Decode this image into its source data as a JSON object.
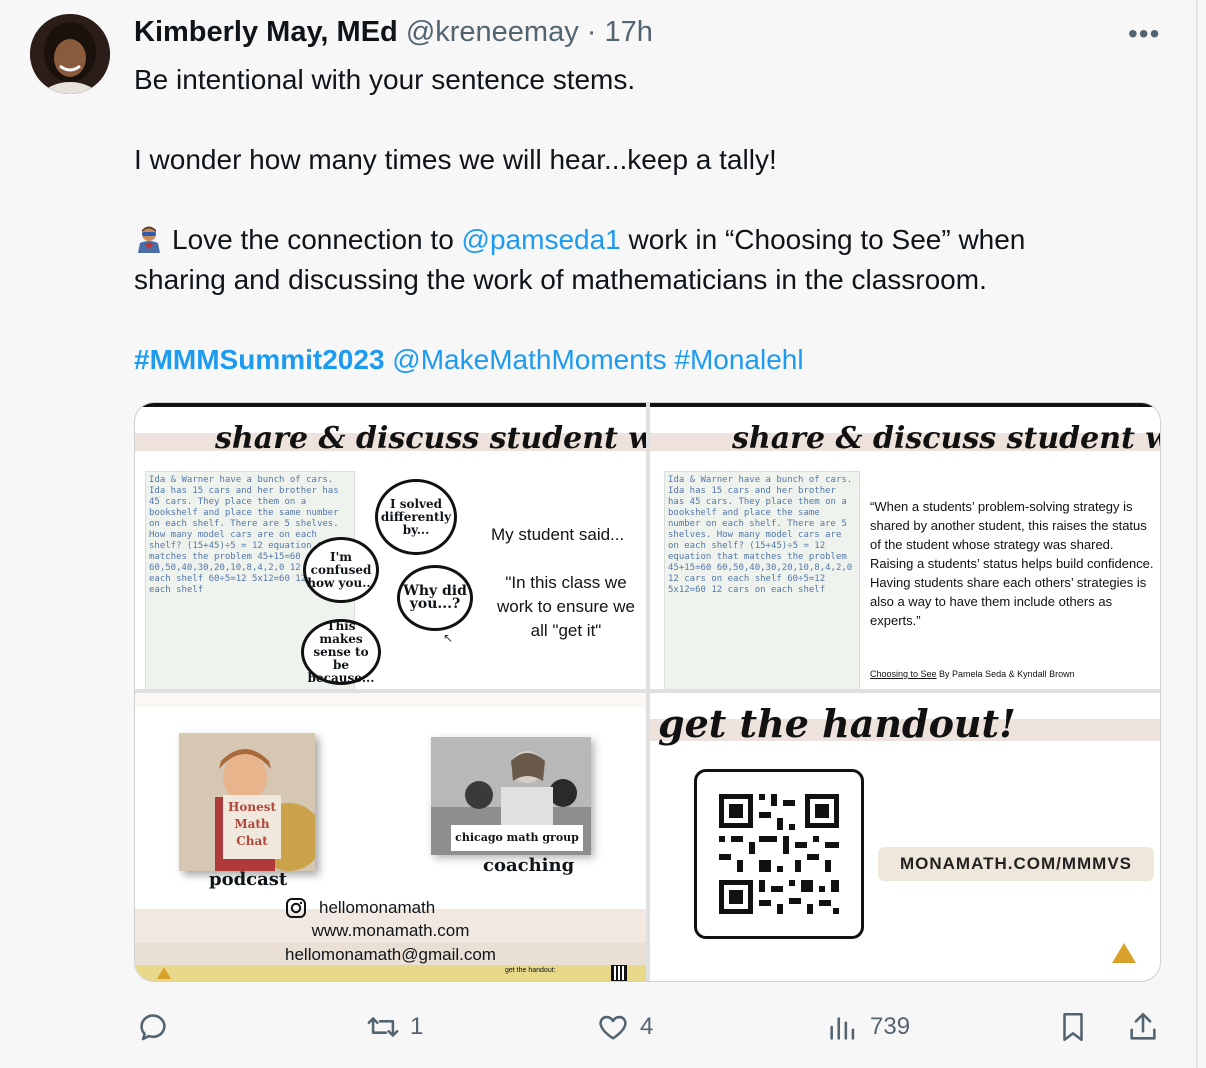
{
  "author": {
    "name": "Kimberly May, MEd",
    "handle": "@kreneemay",
    "time": "· 17h"
  },
  "tweet": {
    "line1": "Be intentional with your sentence stems.",
    "line2": "I wonder how many times we will hear...keep a tally!",
    "line3_pre": "Love the connection to ",
    "line3_mention": "@pamseda1",
    "line3_post": " work in “Choosing to See” when",
    "line4": "sharing and discussing the work of mathematicians in the classroom.",
    "hashtag1": "#MMMSummit2023",
    "mention2": "@MakeMathMoments",
    "hashtag2": "#Monalehl"
  },
  "slide1": {
    "title": "share & discuss student work",
    "bubble1": "I solved differently by...",
    "bubble2": "I'm confused how you...",
    "bubble3": "Why did you...?",
    "bubble4": "This makes sense to be because...",
    "said": "My student said...",
    "quote": "\"In this class we work to ensure we all \"get it\"",
    "notes": "Ida & Warner have a bunch of cars. Ida has 15 cars and her brother has 45 cars. They place them on a bookshelf and place the same number on each shelf. There are 5 shelves. How many model cars are on each shelf? (15+45)÷5 = 12 equation that matches the problem 45+15=60 60,50,40,30,20,10,8,4,2,0 12 cars on each shelf 60÷5=12 5x12=60 12 cars on each shelf"
  },
  "slide2": {
    "title": "share & discuss student work",
    "quote": "“When a students’ problem-solving strategy is shared by another student, this raises the status of the student whose strategy was shared. Raising a students’ status helps build confidence. Having students share each others’ strategies is also a way to have them include others as experts.”",
    "citation_title": "Choosing to See",
    "citation_rest": " By Pamela Seda & Kyndall Brown"
  },
  "slide3": {
    "podcast_cover": "Honest Math Chat",
    "podcast_label": "podcast",
    "coaching_brand": "chicago math group",
    "coaching_label": "coaching",
    "instagram": "hellomonamath",
    "website": "www.monamath.com",
    "email": "hellomonamath@gmail.com",
    "handout": "get the handout:"
  },
  "slide4": {
    "title": "get the handout!",
    "url": "MONAMATH.COM/MMMVS"
  },
  "actions": {
    "reply_count": "",
    "retweet_count": "1",
    "like_count": "4",
    "views_count": "739"
  },
  "colors": {
    "link": "#1d9bf0",
    "muted": "#536471",
    "banner": "#ede3dc"
  }
}
